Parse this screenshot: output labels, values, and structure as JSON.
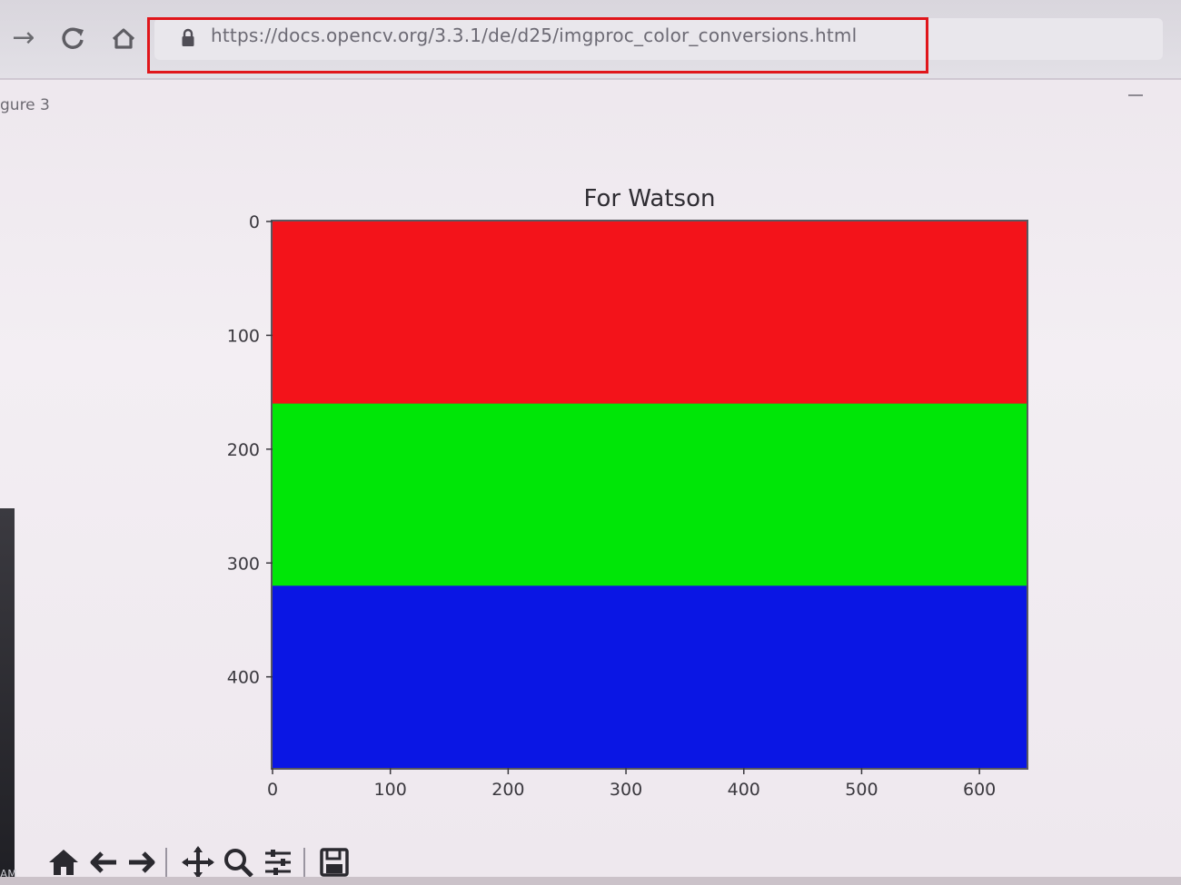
{
  "browser": {
    "url": "https://docs.opencv.org/3.3.1/de/d25/imgproc_color_conversions.html",
    "nav": {
      "forward_icon": "forward-arrow-icon",
      "reload_icon": "reload-icon",
      "home_icon": "home-icon",
      "lock_icon": "lock-icon"
    },
    "highlight_color": "#e0161b"
  },
  "figure": {
    "window_label": "gure 3",
    "left_edge_text": "AM"
  },
  "chart_data": {
    "type": "heatmap",
    "title": "For Watson",
    "xlabel": "",
    "ylabel": "",
    "xlim": [
      0,
      640
    ],
    "ylim": [
      480,
      0
    ],
    "xticks": [
      "0",
      "100",
      "200",
      "300",
      "400",
      "500",
      "600"
    ],
    "yticks": [
      "0",
      "100",
      "200",
      "300",
      "400"
    ],
    "bands": [
      {
        "color": "#f3131a",
        "y_from": 0,
        "y_to": 160
      },
      {
        "color": "#00e607",
        "y_from": 160,
        "y_to": 320
      },
      {
        "color": "#0a16e4",
        "y_from": 320,
        "y_to": 480
      }
    ],
    "grid": false
  },
  "toolbar": {
    "items": [
      {
        "name": "home-icon"
      },
      {
        "name": "back-icon"
      },
      {
        "name": "forward-icon"
      },
      {
        "name": "pan-icon"
      },
      {
        "name": "zoom-icon"
      },
      {
        "name": "configure-subplots-icon"
      },
      {
        "name": "save-icon"
      }
    ]
  }
}
